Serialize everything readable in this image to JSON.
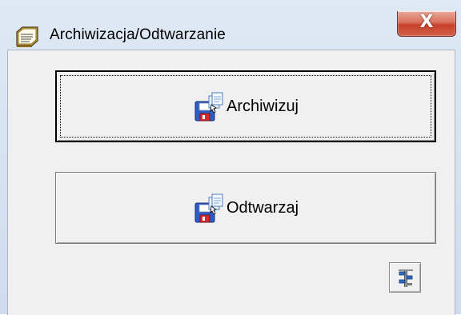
{
  "window": {
    "title": "Archiwizacja/Odtwarzanie",
    "title_icon": "archive-notebook-icon",
    "close_icon": "close-icon",
    "close_glyph": "X"
  },
  "buttons": {
    "archive_label": "Archiwizuj",
    "archive_icon": "floppy-save-icon",
    "restore_label": "Odtwarzaj",
    "restore_icon": "floppy-restore-icon",
    "settings_icon": "settings-tool-icon"
  },
  "colors": {
    "close_button": "#c7412a",
    "dialog_background": "#f0f0f0",
    "title_bar": "#dfe9f5"
  }
}
